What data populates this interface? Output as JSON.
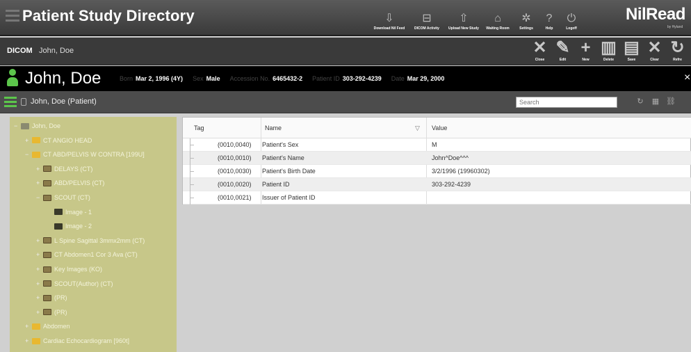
{
  "app": {
    "title": "Patient Study Directory",
    "brand": "NilRead",
    "brand_sub": "by Hyland"
  },
  "toolbar": [
    {
      "label": "Download Nil Feed",
      "icon": "download-icon",
      "glyph": "⇩"
    },
    {
      "label": "DICOM Activity",
      "icon": "activity-icon",
      "glyph": "⊟"
    },
    {
      "label": "Upload New Study",
      "icon": "upload-icon",
      "glyph": "⇧"
    },
    {
      "label": "Waiting Room",
      "icon": "waiting-room-icon",
      "glyph": "⌂"
    },
    {
      "label": "Settings",
      "icon": "gear-icon",
      "glyph": "✲"
    },
    {
      "label": "Help",
      "icon": "help-icon",
      "glyph": "?"
    },
    {
      "label": "Logoff",
      "icon": "power-icon",
      "glyph": "⏻"
    }
  ],
  "dicom_bar": {
    "mode": "DICOM",
    "name": "John, Doe"
  },
  "actions": [
    {
      "label": "Close",
      "icon": "close-icon",
      "glyph": "✕"
    },
    {
      "label": "Edit",
      "icon": "edit-icon",
      "glyph": "✎"
    },
    {
      "label": "New",
      "icon": "new-icon",
      "glyph": "+"
    },
    {
      "label": "Delete",
      "icon": "delete-icon",
      "glyph": "▥"
    },
    {
      "label": "Save",
      "icon": "save-icon",
      "glyph": "▤"
    },
    {
      "label": "Clear",
      "icon": "clear-icon",
      "glyph": "✕"
    },
    {
      "label": "Refre",
      "icon": "refresh-icon",
      "glyph": "↻"
    }
  ],
  "patient": {
    "name": "John, Doe",
    "fields": [
      {
        "key": "Born",
        "value": "Mar 2, 1996 (4Y)"
      },
      {
        "key": "Sex",
        "value": "Male"
      },
      {
        "key": "Accession No.",
        "value": "6465432-2"
      },
      {
        "key": "Patient ID",
        "value": "303-292-4239"
      },
      {
        "key": "Date",
        "value": "Mar 29, 2000"
      }
    ]
  },
  "study_bar": {
    "title": "John, Doe   (Patient)",
    "search_placeholder": "Search"
  },
  "tree": [
    {
      "label": "John, Doe",
      "level": 0,
      "type": "patient",
      "tog": "−"
    },
    {
      "label": "CT ANGIO HEAD",
      "level": 1,
      "type": "folder",
      "tog": "+"
    },
    {
      "label": "CT ABD/PELVIS W CONTRA [199U]",
      "level": 1,
      "type": "folder",
      "tog": "−"
    },
    {
      "label": "DELAYS (CT)",
      "level": 2,
      "type": "series",
      "tog": "+"
    },
    {
      "label": "ABD/PELVIS (CT)",
      "level": 2,
      "type": "series",
      "tog": "+"
    },
    {
      "label": "SCOUT (CT)",
      "level": 2,
      "type": "series",
      "tog": "−"
    },
    {
      "label": "Image - 1",
      "level": 3,
      "type": "image",
      "tog": ""
    },
    {
      "label": "Image - 2",
      "level": 3,
      "type": "image",
      "tog": ""
    },
    {
      "label": "L Spine Sagittal 3mmx2mm (CT)",
      "level": 2,
      "type": "series",
      "tog": "+"
    },
    {
      "label": "CT Abdomen1 Cor 3 Ava (CT)",
      "level": 2,
      "type": "series",
      "tog": "+"
    },
    {
      "label": "Key Images (KO)",
      "level": 2,
      "type": "series",
      "tog": "+"
    },
    {
      "label": "SCOUT(Author) (CT)",
      "level": 2,
      "type": "series",
      "tog": "+"
    },
    {
      "label": "(PR)",
      "level": 2,
      "type": "series",
      "tog": "+"
    },
    {
      "label": "(PR)",
      "level": 2,
      "type": "series",
      "tog": "+"
    },
    {
      "label": "Abdomen",
      "level": 1,
      "type": "folder",
      "tog": "+"
    },
    {
      "label": "Cardiac Echocardiogram [960t]",
      "level": 1,
      "type": "folder",
      "tog": "+"
    }
  ],
  "table": {
    "headers": {
      "tag": "Tag",
      "name": "Name",
      "value": "Value"
    },
    "rows": [
      {
        "tag": "(0010,0040)",
        "name": "Patient's Sex",
        "value": "M"
      },
      {
        "tag": "(0010,0010)",
        "name": "Patient's Name",
        "value": "John^Doe^^^"
      },
      {
        "tag": "(0010,0030)",
        "name": "Patient's Birth Date",
        "value": "3/2/1996 (19960302)"
      },
      {
        "tag": "(0010,0020)",
        "name": "Patient ID",
        "value": "303-292-4239"
      },
      {
        "tag": "(0010,0021)",
        "name": "Issuer of Patient ID",
        "value": ""
      }
    ]
  }
}
